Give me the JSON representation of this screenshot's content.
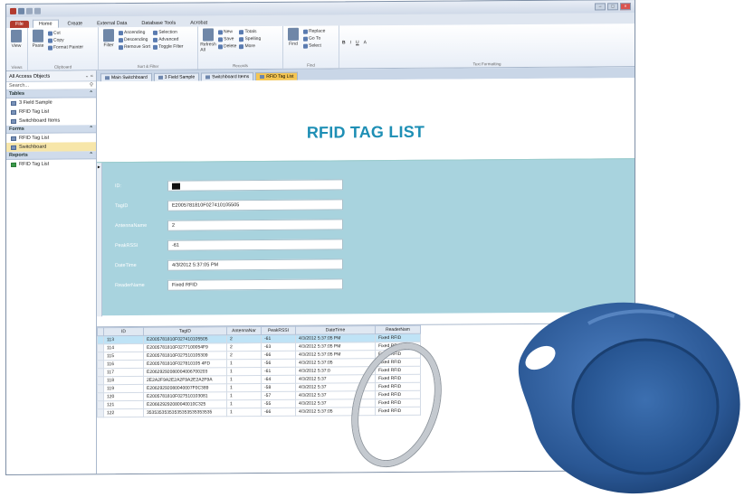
{
  "ribbon": {
    "tabs": [
      "File",
      "Home",
      "Create",
      "External Data",
      "Database Tools",
      "Acrobat"
    ],
    "groups": [
      {
        "label": "Views",
        "items": [
          "View"
        ]
      },
      {
        "label": "Clipboard",
        "items": [
          "Paste",
          "Cut",
          "Copy",
          "Format Painter"
        ]
      },
      {
        "label": "Sort & Filter",
        "items": [
          "Filter",
          "Ascending",
          "Descending",
          "Remove Sort",
          "Selection",
          "Advanced",
          "Toggle Filter"
        ]
      },
      {
        "label": "Records",
        "items": [
          "Refresh All",
          "New",
          "Save",
          "Delete",
          "Totals",
          "Spelling",
          "More"
        ]
      },
      {
        "label": "Find",
        "items": [
          "Find",
          "Replace",
          "Go To",
          "Select"
        ]
      },
      {
        "label": "Text Formatting",
        "items": [
          "B",
          "I",
          "U",
          "A"
        ]
      }
    ]
  },
  "nav": {
    "header": "All Access Objects",
    "search_placeholder": "Search...",
    "sections": [
      {
        "title": "Tables",
        "items": [
          "3 Field Sample",
          "RFID Tag List",
          "Switchboard Items"
        ]
      },
      {
        "title": "Forms",
        "items": [
          "RFID Tag List",
          "Switchboard"
        ]
      },
      {
        "title": "Reports",
        "items": [
          "RFID Tag List"
        ]
      }
    ]
  },
  "doc_tabs": [
    "Main Switchboard",
    "3 Field Sample",
    "Switchboard Items",
    "RFID Tag List"
  ],
  "form": {
    "title": "RFID TAG LIST",
    "fields": [
      {
        "label": "ID:",
        "value": ""
      },
      {
        "label": "TagID",
        "value": "E2005781810F027410105505"
      },
      {
        "label": "AntennaName",
        "value": "2"
      },
      {
        "label": "PeakRSSI",
        "value": "-61"
      },
      {
        "label": "DateTime",
        "value": "4/3/2012 5:37:05 PM"
      },
      {
        "label": "ReaderName",
        "value": "Fixed RFID"
      }
    ]
  },
  "grid": {
    "columns": [
      "ID",
      "TagID",
      "AntennaNar",
      "PeakRSSI",
      "DateTime",
      "ReaderNam"
    ],
    "rows": [
      [
        "113",
        "E2005781810F027410105505",
        "2",
        "-61",
        "4/3/2012 5:37:05 PM",
        "Fixed RFID"
      ],
      [
        "114",
        "E2005781810F0277100054F9",
        "2",
        "-63",
        "4/3/2012 5:37:05 PM",
        "Fixed RFID"
      ],
      [
        "115",
        "E2005781810F027510105309",
        "2",
        "-66",
        "4/3/2012 5:37:05 PM",
        "Fixed RFID"
      ],
      [
        "116",
        "E2005781810F027810105 4FD",
        "1",
        "-56",
        "4/3/2012 5:37:05",
        "Fixed RFID"
      ],
      [
        "117",
        "E20629292080004006700203",
        "1",
        "-61",
        "4/3/2012 5:37:0",
        "Fixed RFID"
      ],
      [
        "118",
        "2E2A2F9A2E2A2F9A2E2A2F9A",
        "1",
        "-64",
        "4/3/2012 5:37",
        "Fixed RFID"
      ],
      [
        "119",
        "E20629292080040007F0C389",
        "1",
        "-58",
        "4/3/2012 5:37",
        "Fixed RFID"
      ],
      [
        "120",
        "E2005781810F027510103081",
        "1",
        "-57",
        "4/3/2012 5:37",
        "Fixed RFID"
      ],
      [
        "121",
        "E206629292080040010C325",
        "1",
        "-55",
        "4/3/2012 5:37",
        "Fixed RFID"
      ],
      [
        "122",
        "35353535353535353535353535",
        "1",
        "-66",
        "4/3/2012 5:37:05",
        "Fixed RFID"
      ]
    ]
  },
  "colors": {
    "accent_title": "#1e8fb5",
    "form_band": "#a8d3de",
    "file_tab": "#b23a2e",
    "active_doc_tab": "#f5c653",
    "fob_blue": "#2f5f9e"
  }
}
